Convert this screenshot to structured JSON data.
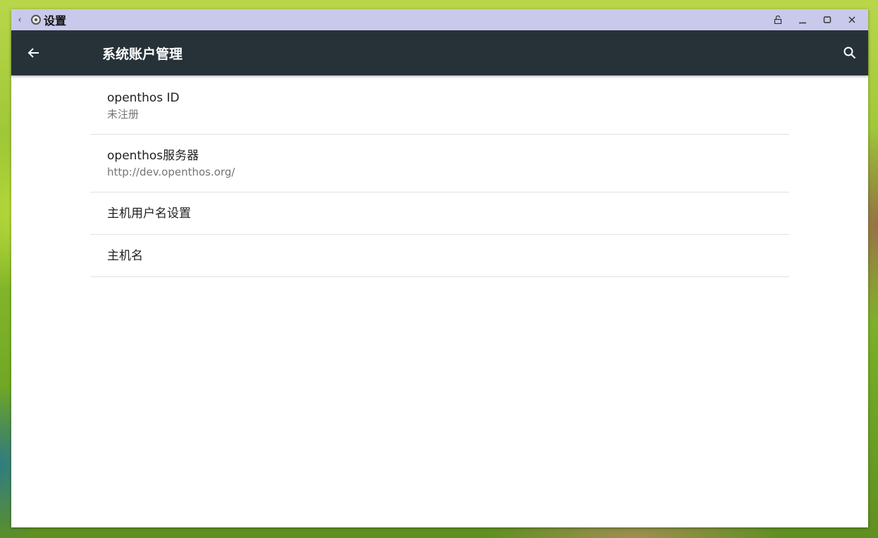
{
  "window": {
    "title": "设置",
    "controls": [
      "lock-icon",
      "minimize-icon",
      "maximize-icon",
      "close-icon"
    ]
  },
  "appbar": {
    "title": "系统账户管理",
    "background": "#263238"
  },
  "titlebar_color": "#c9c9ec",
  "items": [
    {
      "title": "openthos ID",
      "summary": "未注册"
    },
    {
      "title": "openthos服务器",
      "summary": "http://dev.openthos.org/"
    },
    {
      "title": "主机用户名设置"
    },
    {
      "title": "主机名"
    }
  ]
}
